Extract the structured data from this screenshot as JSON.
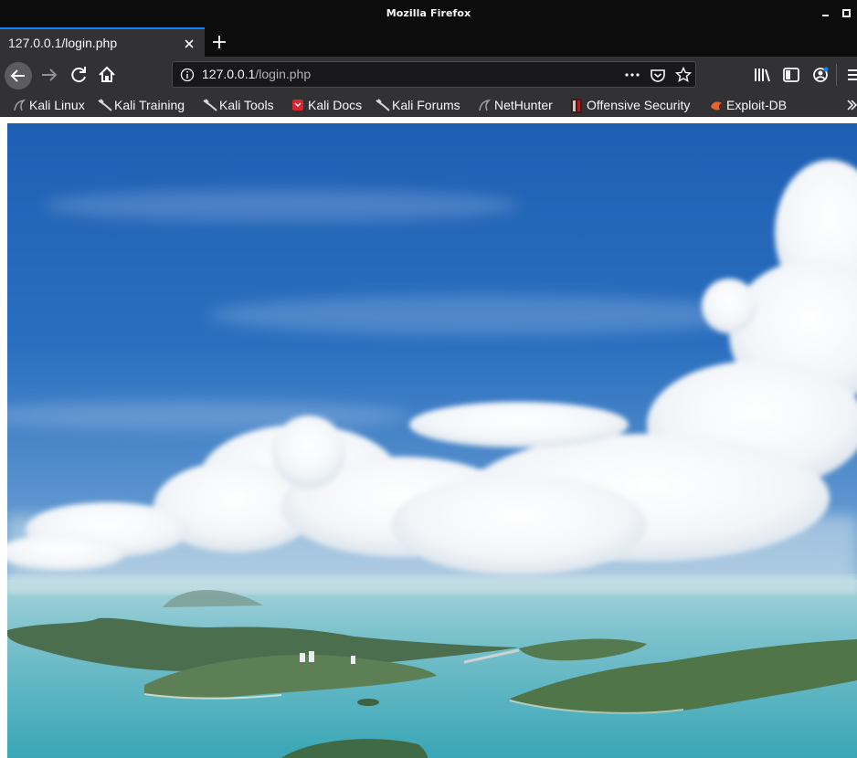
{
  "window": {
    "title": "Mozilla Firefox"
  },
  "tabs": [
    {
      "title": "127.0.0.1/login.php",
      "active": true
    }
  ],
  "urlbar": {
    "host": "127.0.0.1",
    "path": "/login.php"
  },
  "bookmarks": [
    {
      "label": "Kali Linux",
      "icon": "kali-dragon-icon"
    },
    {
      "label": "Kali Training",
      "icon": "kali-dragon-icon"
    },
    {
      "label": "Kali Tools",
      "icon": "kali-dragon-icon"
    },
    {
      "label": "Kali Docs",
      "icon": "kali-docs-icon"
    },
    {
      "label": "Kali Forums",
      "icon": "kali-dragon-icon"
    },
    {
      "label": "NetHunter",
      "icon": "nethunter-icon"
    },
    {
      "label": "Offensive Security",
      "icon": "offsec-icon"
    },
    {
      "label": "Exploit-DB",
      "icon": "exploit-db-icon"
    }
  ],
  "page": {
    "background_image": "aerial view of tropical islands under blue sky with clouds"
  },
  "colors": {
    "accent": "#0a84ff",
    "titlebar": "#0c0c0d",
    "toolbar": "#323234",
    "urlbar": "#18181a"
  }
}
